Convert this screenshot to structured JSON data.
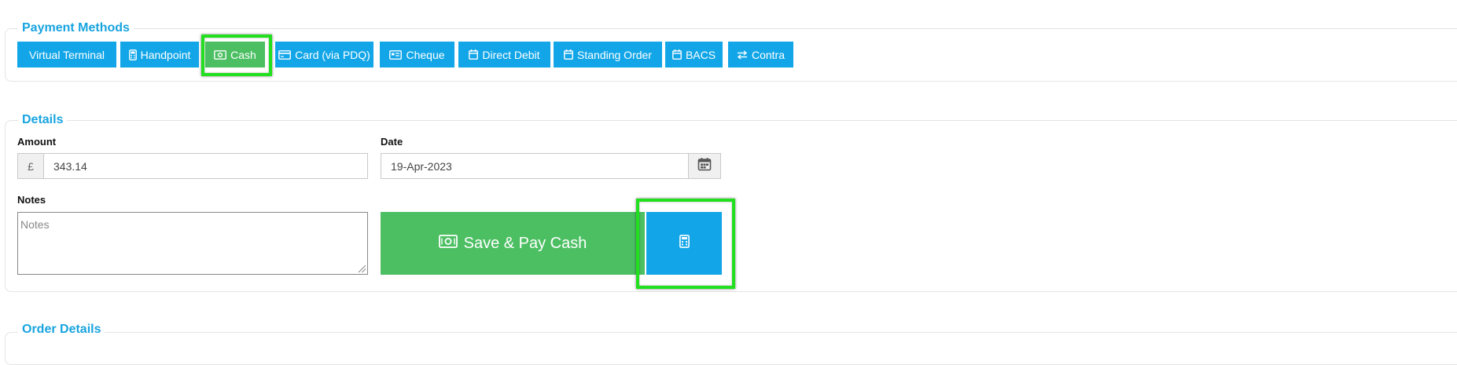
{
  "payment_methods": {
    "legend": "Payment Methods",
    "buttons": [
      {
        "label": "Virtual Terminal",
        "icon": "none"
      },
      {
        "label": "Handpoint",
        "icon": "card-terminal-icon"
      },
      {
        "label": "Cash",
        "icon": "cash-icon",
        "active": true
      },
      {
        "label": "Card (via PDQ)",
        "icon": "credit-card-icon"
      },
      {
        "label": "Cheque",
        "icon": "cheque-icon"
      },
      {
        "label": "Direct Debit",
        "icon": "calendar-icon"
      },
      {
        "label": "Standing Order",
        "icon": "calendar-icon"
      },
      {
        "label": "BACS",
        "icon": "calendar-icon"
      },
      {
        "label": "Contra",
        "icon": "exchange-icon"
      }
    ]
  },
  "details": {
    "legend": "Details",
    "amount_label": "Amount",
    "currency_symbol": "£",
    "amount_value": "343.14",
    "date_label": "Date",
    "date_value": "19-Apr-2023",
    "notes_label": "Notes",
    "notes_placeholder": "Notes",
    "save_label": "Save & Pay Cash"
  },
  "order_details": {
    "legend": "Order Details"
  },
  "colors": {
    "accent_blue": "#12a6e8",
    "success_green": "#4cbf63",
    "highlight_green": "#22e01f",
    "legend_blue": "#18a4e0"
  }
}
